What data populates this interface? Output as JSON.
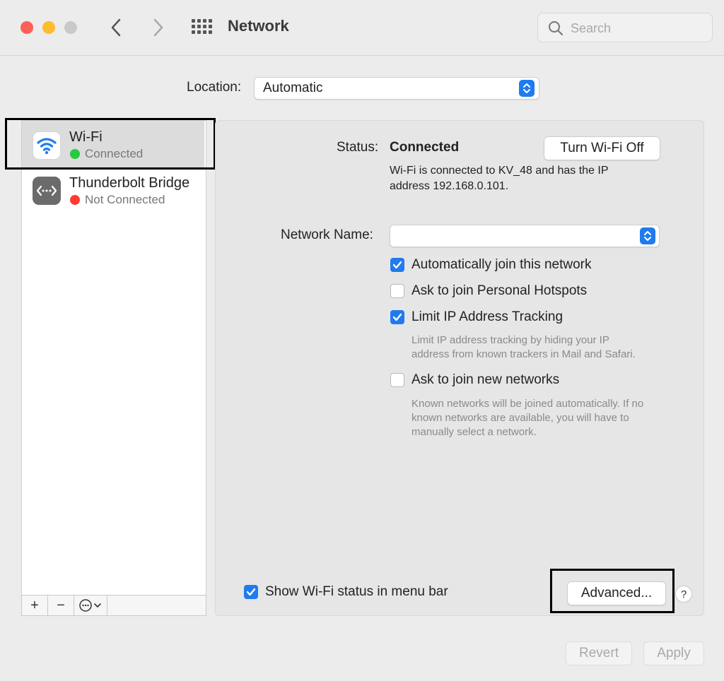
{
  "window": {
    "title": "Network"
  },
  "toolbar": {
    "back_icon": "chevron-left-icon",
    "forward_icon": "chevron-right-icon",
    "grid_icon": "grid-icon",
    "search_placeholder": "Search",
    "search_value": ""
  },
  "traffic_lights": {
    "close": "#fe5f57",
    "minimize": "#febc2e",
    "zoom": "#c9c9c9"
  },
  "location": {
    "label": "Location:",
    "value": "Automatic"
  },
  "sidebar": {
    "items": [
      {
        "name": "Wi-Fi",
        "status": "Connected",
        "status_color": "#28c840",
        "icon": "wifi-icon"
      },
      {
        "name": "Thunderbolt Bridge",
        "status": "Not Connected",
        "status_color": "#ff3b30",
        "icon": "thunderbolt-bridge-icon"
      }
    ],
    "buttons": {
      "add": "+",
      "remove": "−",
      "action": "⋯"
    }
  },
  "detail": {
    "status_label": "Status:",
    "status_value": "Connected",
    "turn_off_button": "Turn Wi-Fi Off",
    "status_desc_line1": "Wi-Fi is connected to KV_48 and has the IP",
    "status_desc_line2": "address 192.168.0.101.",
    "network_name_label": "Network Name:",
    "network_name_value": "",
    "options": [
      {
        "label": "Automatically join this network",
        "checked": true
      },
      {
        "label": "Ask to join Personal Hotspots",
        "checked": false
      },
      {
        "label": "Limit IP Address Tracking",
        "checked": true,
        "desc_line1": "Limit IP address tracking by hiding your IP",
        "desc_line2": "address from known trackers in Mail and Safari."
      },
      {
        "label": "Ask to join new networks",
        "checked": false,
        "desc_line1": "Known networks will be joined automatically. If no",
        "desc_line2": "known networks are available, you will have to",
        "desc_line3": "manually select a network."
      }
    ],
    "show_status_label": "Show Wi-Fi status in menu bar",
    "show_status_checked": true,
    "advanced_button": "Advanced...",
    "help_button": "?"
  },
  "footer": {
    "revert": "Revert",
    "apply": "Apply"
  },
  "accent_color": "#1f7bef"
}
